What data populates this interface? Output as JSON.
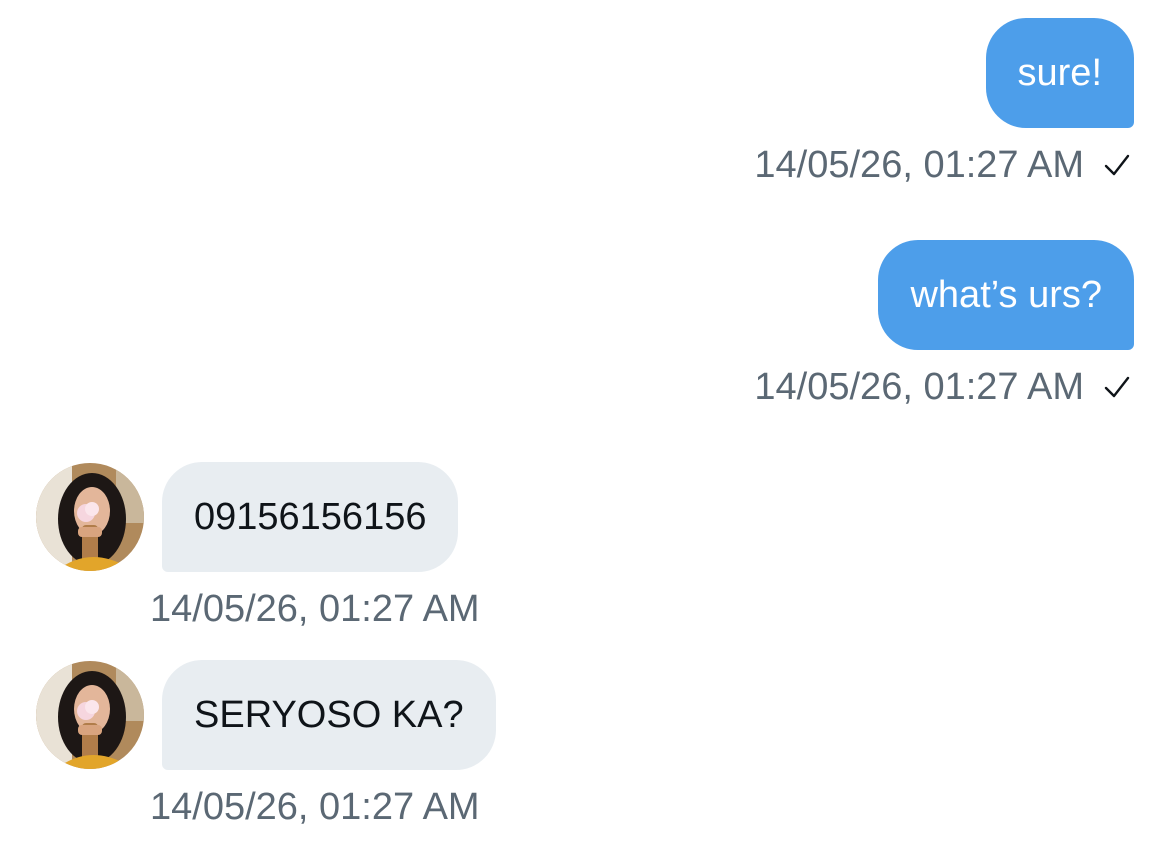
{
  "conversation": {
    "messages": [
      {
        "direction": "outgoing",
        "text": "sure!",
        "timestamp": "14/05/26, 01:27 AM",
        "status_icon": "checkmark-icon"
      },
      {
        "direction": "outgoing",
        "text": "what’s urs?",
        "timestamp": "14/05/26, 01:27 AM",
        "status_icon": "checkmark-icon"
      },
      {
        "direction": "incoming",
        "text": "09156156156",
        "timestamp": "14/05/26, 01:27 AM",
        "avatar": "user-avatar"
      },
      {
        "direction": "incoming",
        "text": "SERYOSO KA?",
        "timestamp": "14/05/26, 01:27 AM",
        "avatar": "user-avatar"
      }
    ]
  },
  "colors": {
    "outgoing_bubble": "#4d9eea",
    "incoming_bubble": "#e8edf1",
    "timestamp_text": "#5b6874",
    "incoming_text": "#0f1419"
  }
}
